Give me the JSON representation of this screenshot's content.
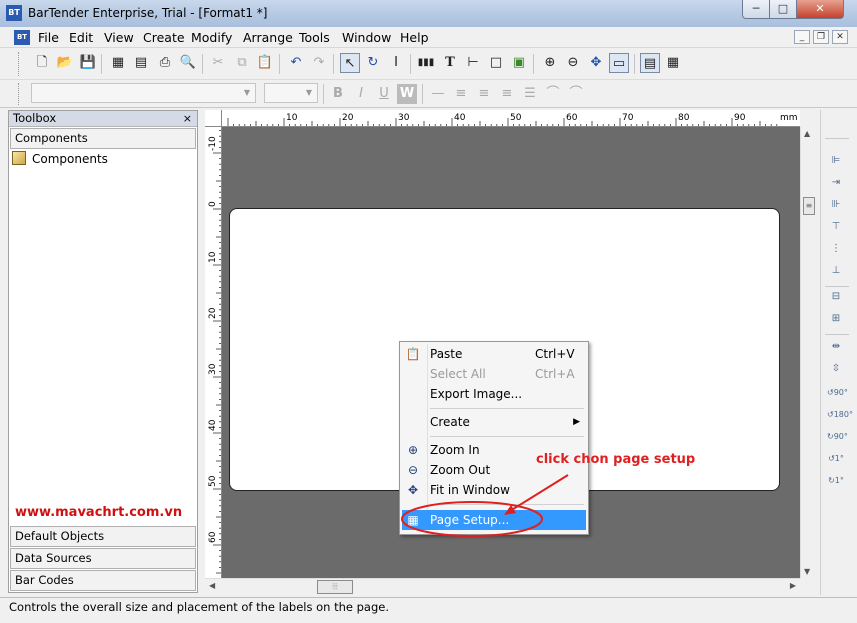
{
  "window": {
    "title": "BarTender Enterprise, Trial - [Format1 *]",
    "app_icon_text": "BT",
    "min_symbol": "─",
    "max_symbol": "□",
    "close_symbol": "✕"
  },
  "menubar": {
    "doc_icon_text": "BT",
    "items": [
      "File",
      "Edit",
      "View",
      "Create",
      "Modify",
      "Arrange",
      "Tools",
      "Window",
      "Help"
    ],
    "mdi_min": "_",
    "mdi_restore": "❐",
    "mdi_close": "✕"
  },
  "toolbar": {
    "buttons": [
      "new-document-icon",
      "open-folder-icon",
      "save-icon",
      "page-setup-icon",
      "database-setup-icon",
      "print-icon",
      "print-preview-icon",
      "cut-icon",
      "copy-icon",
      "paste-icon",
      "undo-icon",
      "redo-icon",
      "select-pointer-icon",
      "rotate-icon",
      "text-cursor-icon",
      "barcode-icon",
      "text-tool-icon",
      "line-tool-icon",
      "box-tool-icon",
      "picture-tool-icon",
      "zoom-in-icon",
      "zoom-out-icon",
      "fit-window-icon",
      "template-icon",
      "keyboard-icon",
      "bitmap-icon"
    ],
    "format_buttons": [
      "B",
      "I",
      "U",
      "W"
    ]
  },
  "toolbox": {
    "header": "Toolbox",
    "close": "×",
    "section": "Components",
    "tree_item": "Components",
    "watermark": "www.mavachrt.com.vn",
    "bottom_tabs": [
      "Default Objects",
      "Data Sources",
      "Bar Codes"
    ]
  },
  "ruler": {
    "top_labels": [
      "10",
      "20",
      "30",
      "40",
      "50",
      "60",
      "70",
      "80",
      "90"
    ],
    "unit": "mm",
    "left_labels": [
      "-10",
      "0",
      "10",
      "20",
      "30",
      "40",
      "50",
      "60"
    ]
  },
  "context_menu": {
    "items": [
      {
        "label": "Paste",
        "shortcut": "Ctrl+V",
        "icon": "paste-icon",
        "disabled": false
      },
      {
        "label": "Select All",
        "shortcut": "Ctrl+A",
        "icon": "",
        "disabled": true
      },
      {
        "label": "Export Image...",
        "shortcut": "",
        "icon": "",
        "disabled": false
      },
      {
        "label": "Create",
        "shortcut": "",
        "icon": "",
        "disabled": false,
        "submenu": true
      },
      {
        "label": "Zoom In",
        "shortcut": "",
        "icon": "zoom-in-icon",
        "disabled": false
      },
      {
        "label": "Zoom Out",
        "shortcut": "",
        "icon": "zoom-out-icon",
        "disabled": false
      },
      {
        "label": "Fit in Window",
        "shortcut": "",
        "icon": "fit-window-icon",
        "disabled": false
      },
      {
        "label": "Page Setup...",
        "shortcut": "",
        "icon": "page-setup-icon",
        "disabled": false,
        "highlighted": true
      }
    ],
    "submenu_arrow": "▶"
  },
  "annotation": {
    "text": "click chon page setup",
    "color": "#e02020"
  },
  "statusbar": {
    "text": "Controls the overall size and placement of the labels on the page."
  },
  "colors": {
    "canvas_bg": "#6b6b6b",
    "highlight": "#3399ff",
    "watermark": "#d01010"
  }
}
